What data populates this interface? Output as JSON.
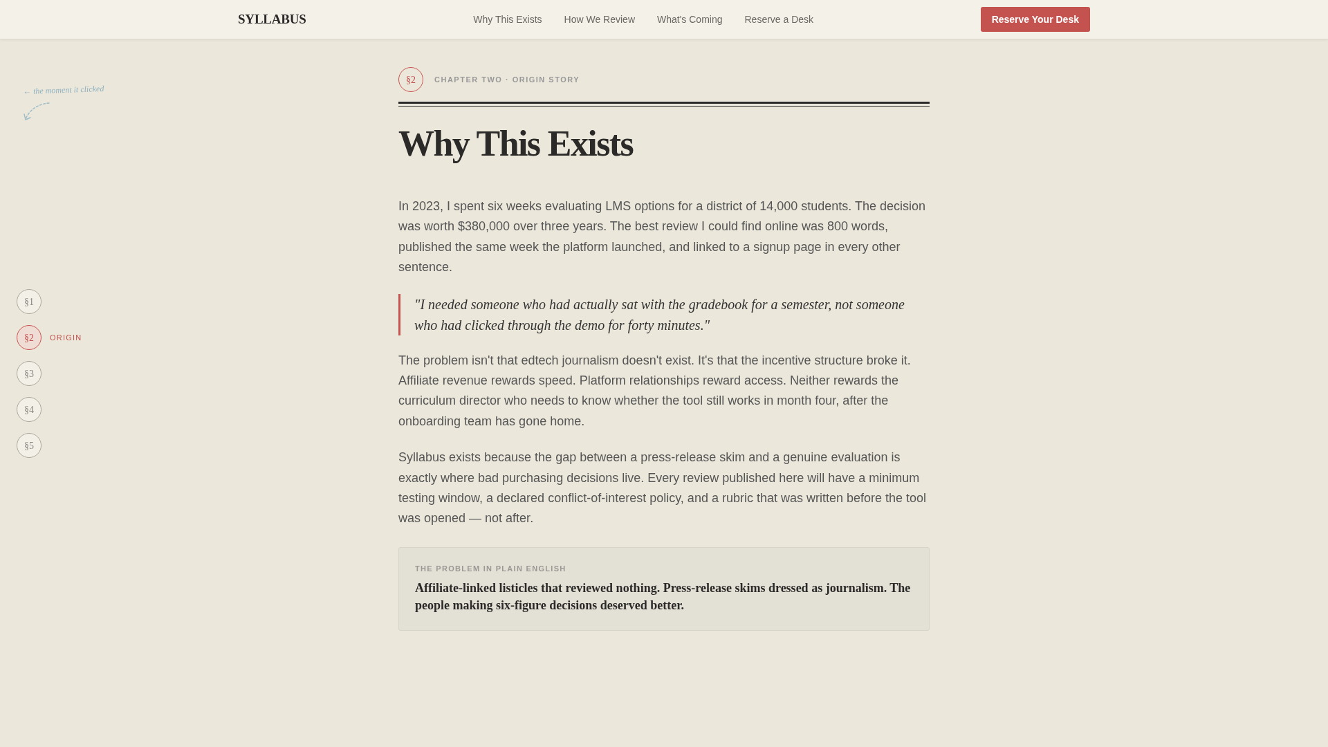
{
  "navbar": {
    "brand": "SYLLABUS",
    "links": [
      {
        "label": "Why This Exists"
      },
      {
        "label": "How We Review"
      },
      {
        "label": "What's Coming"
      },
      {
        "label": "Reserve a Desk"
      }
    ],
    "cta": "Reserve Your Desk"
  },
  "margin_note": {
    "text": "← the moment it clicked"
  },
  "section_nav": [
    {
      "label": "§1",
      "selected": false
    },
    {
      "label": "§2",
      "selected": true,
      "caption": "ORIGIN"
    },
    {
      "label": "§3",
      "selected": false
    },
    {
      "label": "§4",
      "selected": false
    },
    {
      "label": "§5",
      "selected": false
    }
  ],
  "chapter": {
    "badge": "§2",
    "eyebrow": "CHAPTER TWO · ORIGIN STORY",
    "title": "Why This Exists"
  },
  "blocks": [
    {
      "kind": "paragraph",
      "text": "In 2023, I spent six weeks evaluating LMS options for a district of 14,000 students. The decision was worth $380,000 over three years. The best review I could find online was 800 words, published the same week the platform launched, and linked to a signup page in every other sentence."
    },
    {
      "kind": "quote",
      "text": "\"I needed someone who had actually sat with the gradebook for a semester, not someone who had clicked through the demo for forty minutes.\""
    },
    {
      "kind": "paragraph",
      "text": "The problem isn't that edtech journalism doesn't exist. It's that the incentive structure broke it. Affiliate revenue rewards speed. Platform relationships reward access. Neither rewards the curriculum director who needs to know whether the tool still works in month four, after the onboarding team has gone home."
    },
    {
      "kind": "paragraph",
      "text": "Syllabus exists because the gap between a press-release skim and a genuine evaluation is exactly where bad purchasing decisions live. Every review published here will have a minimum testing window, a declared conflict-of-interest policy, and a rubric that was written before the tool was opened — not after."
    },
    {
      "kind": "callout",
      "label": "THE PROBLEM IN PLAIN ENGLISH",
      "text": "Affiliate-linked listicles that reviewed nothing. Press-release skims dressed as journalism. The people making six-figure decisions deserved better."
    }
  ]
}
